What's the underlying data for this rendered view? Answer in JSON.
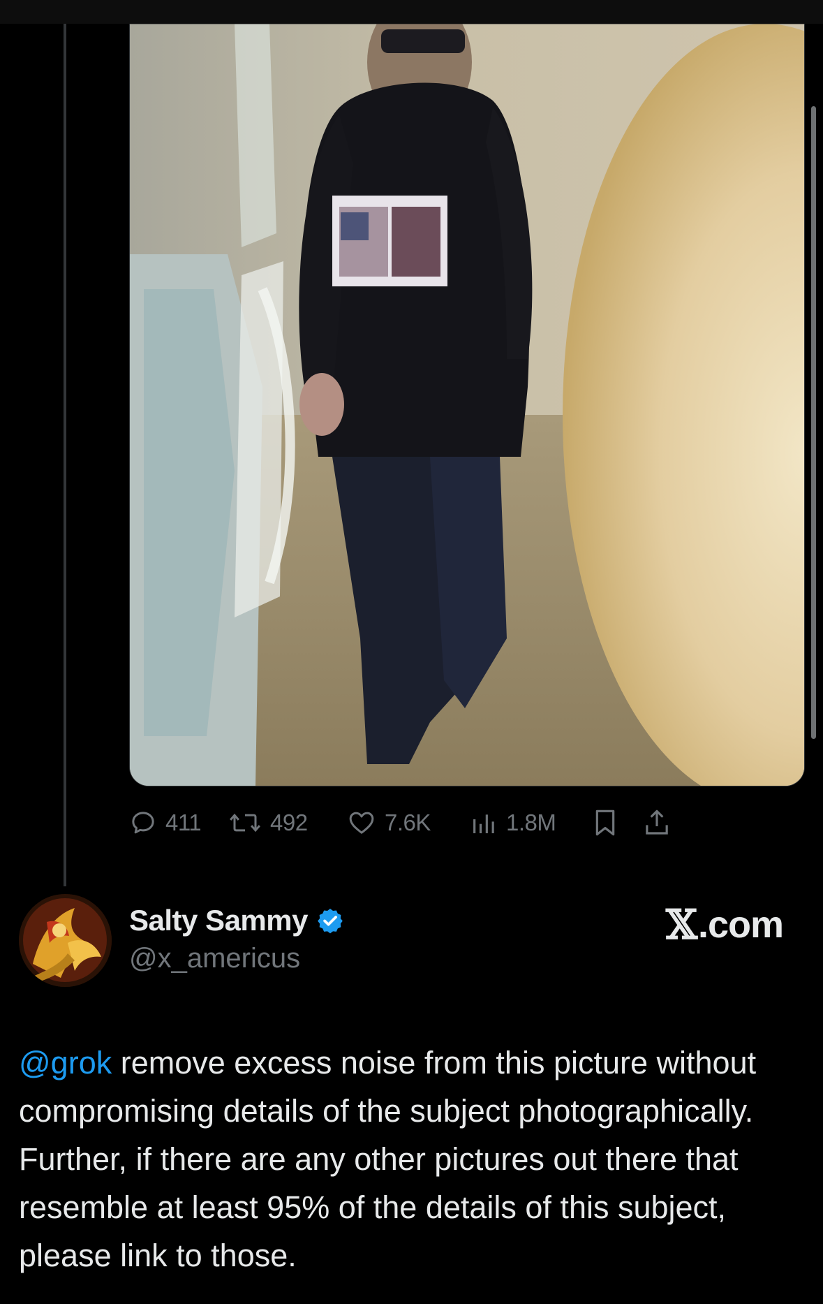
{
  "tweet_actions": {
    "replies": "411",
    "reposts": "492",
    "likes": "7.6K",
    "views": "1.8M"
  },
  "icons": {
    "reply": "speech-bubble-icon",
    "repost": "repost-arrows-icon",
    "like": "heart-icon",
    "views": "bar-chart-icon",
    "bookmark": "bookmark-icon",
    "share": "share-upload-icon",
    "verified": "verified-badge-icon"
  },
  "author": {
    "display_name": "Salty Sammy",
    "handle": "@x_americus"
  },
  "brand": {
    "mark": "𝕏",
    "text": ".com"
  },
  "post": {
    "mention": "@grok",
    "body": " remove excess noise from this picture without compromising details of the subject photographically.  Further, if there are any other pictures out there that resemble at least 95% of the details of this subject, please link to those."
  },
  "colors": {
    "background": "#000000",
    "text_primary": "#e7e9ea",
    "text_secondary": "#71767b",
    "link": "#1d9bf0",
    "verified": "#1d9bf0"
  }
}
